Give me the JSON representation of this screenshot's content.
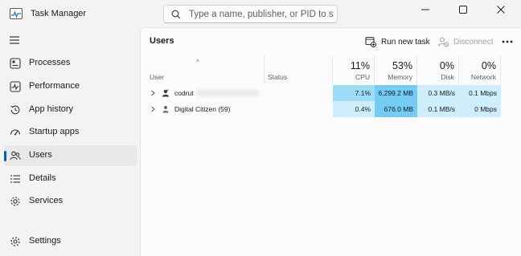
{
  "app": {
    "title": "Task Manager"
  },
  "search": {
    "placeholder": "Type a name, publisher, or PID to sear..."
  },
  "sidebar": {
    "items": [
      {
        "label": "Processes",
        "icon": "processes-icon"
      },
      {
        "label": "Performance",
        "icon": "performance-icon"
      },
      {
        "label": "App history",
        "icon": "app-history-icon"
      },
      {
        "label": "Startup apps",
        "icon": "startup-apps-icon"
      },
      {
        "label": "Users",
        "icon": "users-icon",
        "active": true
      },
      {
        "label": "Details",
        "icon": "details-icon"
      },
      {
        "label": "Services",
        "icon": "services-icon"
      }
    ],
    "settings": {
      "label": "Settings",
      "icon": "settings-icon"
    }
  },
  "main": {
    "title": "Users",
    "toolbar": {
      "run_new_task": "Run new task",
      "disconnect": "Disconnect"
    },
    "columns": {
      "user": "User",
      "status": "Status",
      "cpu": {
        "label": "CPU",
        "percent": "11%"
      },
      "memory": {
        "label": "Memory",
        "percent": "53%"
      },
      "disk": {
        "label": "Disk",
        "percent": "0%"
      },
      "network": {
        "label": "Network",
        "percent": "0%"
      }
    },
    "rows": [
      {
        "name": "codrut",
        "status": "",
        "cpu": "7.1%",
        "memory": "6,299.2 MB",
        "disk": "0.3 MB/s",
        "network": "0.1 Mbps"
      },
      {
        "name": "Digital Citizen (59)",
        "status": "",
        "cpu": "0.4%",
        "memory": "676.0 MB",
        "disk": "0.1 MB/s",
        "network": "0 Mbps"
      }
    ]
  },
  "colors": {
    "accent": "#005fb8",
    "heat_cpu_row1": "#9fdcf8",
    "heat_memory_row1": "#74cbf5",
    "heat_light": "#cfeefc"
  }
}
